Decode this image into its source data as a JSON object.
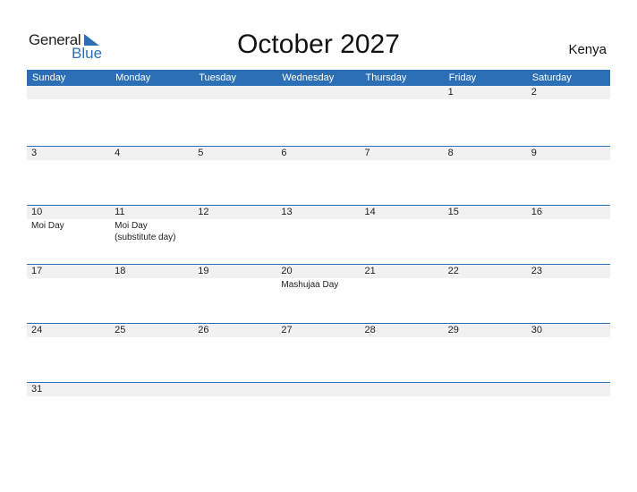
{
  "logo": {
    "general": "General",
    "blue": "Blue",
    "icon": "triangle-flag-icon",
    "color": "#2c6fb4"
  },
  "title": "October 2027",
  "country": "Kenya",
  "header_color": "#2c6fb4",
  "weekdays": [
    "Sunday",
    "Monday",
    "Tuesday",
    "Wednesday",
    "Thursday",
    "Friday",
    "Saturday"
  ],
  "weeks": [
    [
      {
        "day": ""
      },
      {
        "day": ""
      },
      {
        "day": ""
      },
      {
        "day": ""
      },
      {
        "day": ""
      },
      {
        "day": "1"
      },
      {
        "day": "2"
      }
    ],
    [
      {
        "day": "3"
      },
      {
        "day": "4"
      },
      {
        "day": "5"
      },
      {
        "day": "6"
      },
      {
        "day": "7"
      },
      {
        "day": "8"
      },
      {
        "day": "9"
      }
    ],
    [
      {
        "day": "10",
        "holiday": "Moi Day"
      },
      {
        "day": "11",
        "holiday": "Moi Day (substitute day)"
      },
      {
        "day": "12"
      },
      {
        "day": "13"
      },
      {
        "day": "14"
      },
      {
        "day": "15"
      },
      {
        "day": "16"
      }
    ],
    [
      {
        "day": "17"
      },
      {
        "day": "18"
      },
      {
        "day": "19"
      },
      {
        "day": "20",
        "holiday": "Mashujaa Day"
      },
      {
        "day": "21"
      },
      {
        "day": "22"
      },
      {
        "day": "23"
      }
    ],
    [
      {
        "day": "24"
      },
      {
        "day": "25"
      },
      {
        "day": "26"
      },
      {
        "day": "27"
      },
      {
        "day": "28"
      },
      {
        "day": "29"
      },
      {
        "day": "30"
      }
    ],
    [
      {
        "day": "31"
      },
      {
        "day": ""
      },
      {
        "day": ""
      },
      {
        "day": ""
      },
      {
        "day": ""
      },
      {
        "day": ""
      },
      {
        "day": ""
      }
    ]
  ]
}
